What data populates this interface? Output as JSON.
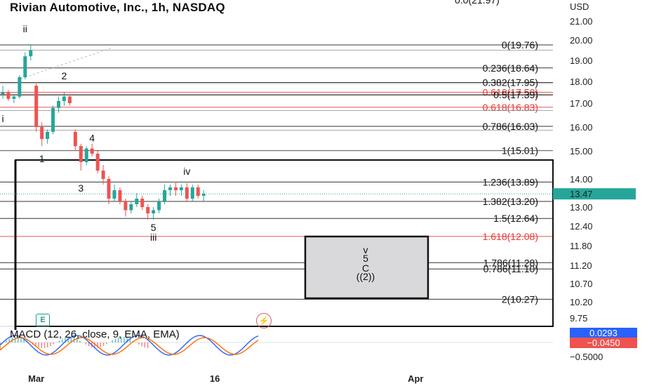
{
  "header": {
    "title": "Rivian Automotive, Inc., 1h, NASDAQ",
    "top_cut_label": "0.0(21.97)"
  },
  "macd": {
    "label": "MACD (12, 26, close, 9, EMA, EMA)",
    "value_blue": "0.0293",
    "value_red": "−0.0450",
    "axis_label": "−0.5000",
    "colors": {
      "macd": "#2962ff",
      "signal": "#ff6d00",
      "hist_pos": "#26a69a",
      "hist_neg": "#ef5350"
    }
  },
  "buttons": {
    "e_label": "E",
    "flash_icon": "lightning-icon"
  },
  "chart_data": {
    "type": "candlestick",
    "title": "Rivian Automotive, Inc., 1h, NASDAQ",
    "currency": "USD",
    "last_price": 13.47,
    "last_price_label": "13.47",
    "y_ticks": [
      "21.00",
      "20.00",
      "19.00",
      "18.00",
      "17.00",
      "16.00",
      "15.00",
      "14.00",
      "13.00",
      "12.40",
      "11.80",
      "11.20",
      "10.70",
      "10.20",
      "9.75"
    ],
    "y_tick_values": [
      21.0,
      20.0,
      19.0,
      18.0,
      17.0,
      16.0,
      15.0,
      14.0,
      13.0,
      12.4,
      11.8,
      11.2,
      10.7,
      10.2,
      9.75
    ],
    "x_ticks": [
      {
        "label": "Mar",
        "bar": 6
      },
      {
        "label": "16",
        "bar": 38
      },
      {
        "label": "Apr",
        "bar": 74
      }
    ],
    "colors": {
      "up": "#26a69a",
      "down": "#ef5350",
      "fib_black": "#111111",
      "fib_red": "#e53935",
      "price_badge": "#26a69a"
    },
    "fib_levels": [
      {
        "label": "0(19.76)",
        "price": 19.76,
        "color": "black"
      },
      {
        "label": "0.236(18.64)",
        "price": 18.64,
        "color": "black"
      },
      {
        "label": "0.382(17.95)",
        "price": 17.95,
        "color": "black"
      },
      {
        "label": "0.618(17.50)",
        "price": 17.5,
        "color": "red"
      },
      {
        "label": "0.5(17.39)",
        "price": 17.39,
        "color": "black"
      },
      {
        "label": "0.618(16.83)",
        "price": 16.83,
        "color": "red"
      },
      {
        "label": "0.786(16.03)",
        "price": 16.03,
        "color": "black"
      },
      {
        "label": "1(15.01)",
        "price": 15.01,
        "color": "black"
      },
      {
        "label": "1.236(13.89)",
        "price": 13.89,
        "color": "black"
      },
      {
        "label": "1.382(13.20)",
        "price": 13.2,
        "color": "black"
      },
      {
        "label": "1.5(12.64)",
        "price": 12.64,
        "color": "black"
      },
      {
        "label": "1.618(12.08)",
        "price": 12.08,
        "color": "red"
      },
      {
        "label": "1.786(11.28)",
        "price": 11.28,
        "color": "black"
      },
      {
        "label": "0.786(11.10)",
        "price": 11.1,
        "color": "black"
      },
      {
        "label": "2(10.27)",
        "price": 10.27,
        "color": "black"
      }
    ],
    "wave_labels": [
      {
        "text": "ii",
        "bar": 4,
        "price": 20.4
      },
      {
        "text": "2",
        "bar": 11,
        "price": 18.1
      },
      {
        "text": "i",
        "bar": 0,
        "price": 16.2
      },
      {
        "text": "1",
        "bar": 7,
        "price": 14.6
      },
      {
        "text": "4",
        "bar": 16,
        "price": 15.4
      },
      {
        "text": "3",
        "bar": 14,
        "price": 13.55
      },
      {
        "text": "iv",
        "bar": 33,
        "price": 14.15
      },
      {
        "text": "5",
        "bar": 27,
        "price": 12.25
      },
      {
        "text": "iii",
        "bar": 27,
        "price": 11.95
      }
    ],
    "target_box_labels": [
      "v",
      "5",
      "C",
      "((2))"
    ],
    "candles": [
      [
        17.4,
        17.8,
        17.2,
        17.5
      ],
      [
        17.5,
        17.6,
        17.1,
        17.2
      ],
      [
        17.2,
        17.4,
        17.0,
        17.3
      ],
      [
        17.3,
        18.3,
        17.2,
        18.2
      ],
      [
        18.2,
        19.4,
        18.1,
        19.2
      ],
      [
        19.2,
        19.76,
        19.0,
        19.5
      ],
      [
        17.8,
        17.9,
        15.8,
        16.0
      ],
      [
        16.0,
        16.2,
        15.2,
        15.5
      ],
      [
        15.5,
        15.9,
        15.3,
        15.8
      ],
      [
        15.8,
        16.9,
        15.7,
        16.8
      ],
      [
        16.8,
        17.3,
        16.6,
        17.1
      ],
      [
        17.1,
        17.5,
        16.9,
        17.3
      ],
      [
        17.3,
        17.4,
        16.9,
        17.0
      ],
      [
        15.8,
        15.9,
        15.0,
        15.2
      ],
      [
        15.2,
        15.3,
        14.3,
        14.6
      ],
      [
        14.6,
        15.2,
        14.5,
        15.1
      ],
      [
        15.1,
        15.3,
        14.8,
        14.9
      ],
      [
        14.9,
        15.0,
        14.2,
        14.3
      ],
      [
        14.3,
        14.5,
        13.8,
        14.0
      ],
      [
        14.0,
        14.1,
        13.1,
        13.3
      ],
      [
        13.3,
        13.8,
        13.2,
        13.6
      ],
      [
        13.6,
        13.7,
        13.1,
        13.2
      ],
      [
        13.2,
        13.3,
        12.7,
        12.9
      ],
      [
        12.9,
        13.2,
        12.8,
        13.1
      ],
      [
        13.1,
        13.5,
        13.0,
        13.3
      ],
      [
        13.3,
        13.4,
        12.9,
        13.0
      ],
      [
        13.0,
        13.1,
        12.6,
        12.8
      ],
      [
        12.8,
        13.0,
        12.6,
        12.9
      ],
      [
        12.9,
        13.3,
        12.8,
        13.2
      ],
      [
        13.2,
        13.8,
        13.1,
        13.6
      ],
      [
        13.6,
        13.8,
        13.4,
        13.7
      ],
      [
        13.7,
        13.9,
        13.4,
        13.6
      ],
      [
        13.6,
        13.8,
        13.4,
        13.7
      ],
      [
        13.7,
        13.85,
        13.2,
        13.3
      ],
      [
        13.3,
        13.8,
        13.2,
        13.7
      ],
      [
        13.7,
        13.8,
        13.3,
        13.4
      ],
      [
        13.4,
        13.6,
        13.2,
        13.47
      ]
    ]
  }
}
